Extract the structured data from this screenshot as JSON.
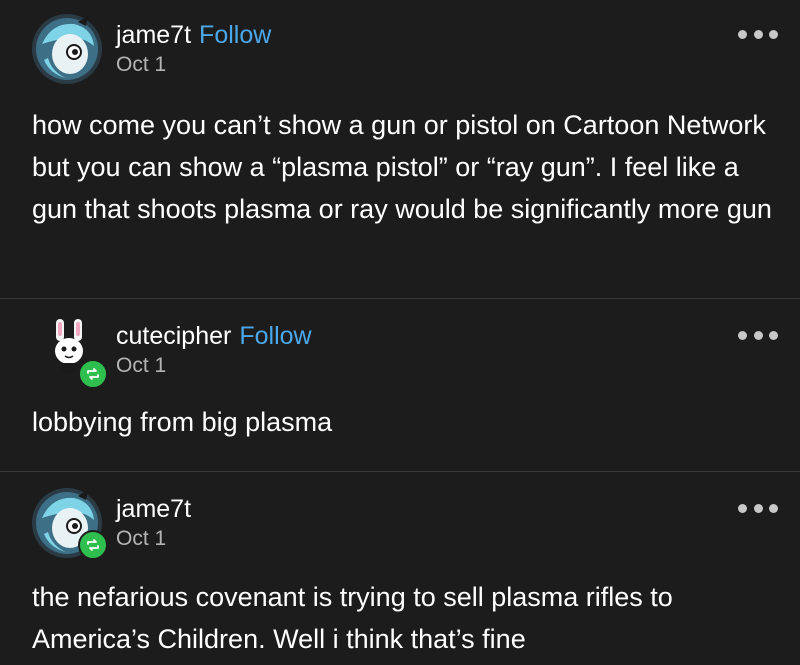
{
  "posts": [
    {
      "username": "jame7t",
      "follow_label": "Follow",
      "date": "Oct 1",
      "body": "how come you can’t show a gun or pistol on Cartoon Network but you can show a “plasma pistol” or “ray gun”. I feel like a gun that shoots plasma or ray would be significantly more gun"
    },
    {
      "username": "cutecipher",
      "follow_label": "Follow",
      "date": "Oct 1",
      "body": "lobbying from big plasma"
    },
    {
      "username": "jame7t",
      "date": "Oct 1",
      "body": "the nefarious covenant is trying to sell plasma rifles to America’s Children. Well i think that’s fine"
    }
  ],
  "colors": {
    "background": "#1c1c1c",
    "follow_link": "#4aa8ea",
    "reblog_badge": "#2fbf4f",
    "date_text": "#b4b4b4"
  },
  "icons": {
    "more": "more-options-icon",
    "reblog": "reblog-icon"
  }
}
